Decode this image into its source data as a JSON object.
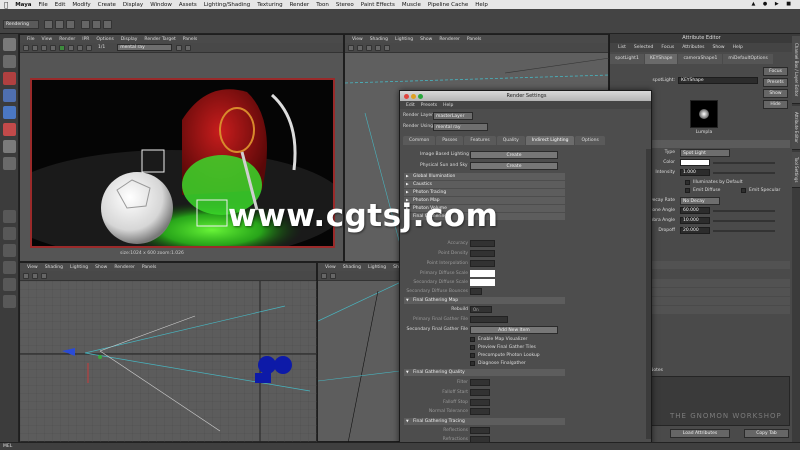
{
  "menubar": {
    "app": "Maya",
    "items": [
      "File",
      "Edit",
      "Modify",
      "Create",
      "Display",
      "Window",
      "Assets",
      "Lighting/Shading",
      "Texturing",
      "Render",
      "Toon",
      "Stereo",
      "Paint Effects",
      "Muscle",
      "Pipeline Cache",
      "Help"
    ]
  },
  "statusline": {
    "mode": "Rendering"
  },
  "render_view": {
    "menu": [
      "File",
      "View",
      "Render",
      "IPR",
      "Options",
      "Display",
      "Render Target",
      "Panels"
    ],
    "frame_label": "1/1",
    "camera_dropdown": "mental ray",
    "caption": "size:1024 x 600  zoom:1.026"
  },
  "persp_top": {
    "menu": [
      "View",
      "Shading",
      "Lighting",
      "Show",
      "Renderer",
      "Panels"
    ]
  },
  "vp_top": {
    "menu": [
      "View",
      "Shading",
      "Lighting",
      "Show",
      "Renderer",
      "Panels"
    ]
  },
  "vp_persp": {
    "menu": [
      "View",
      "Shading",
      "Lighting",
      "Show",
      "Renderer",
      "Panels"
    ]
  },
  "attribute_editor": {
    "title": "Attribute Editor",
    "menu": [
      "List",
      "Selected",
      "Focus",
      "Attributes",
      "Show",
      "Help"
    ],
    "tabs": [
      "spotLight1",
      "KEYShape",
      "cameraShape1",
      "miDefaultOptions"
    ],
    "node_label": "spotLight:",
    "node_value": "KEYShape",
    "focus_button": "Focus",
    "presets_button": "Presets",
    "show_button": "Show",
    "hide_button": "Hide",
    "swatch_label": "Lumpla",
    "section_title": "Light Attributes",
    "type_label": "Type",
    "type_value": "Spot Light",
    "color_label": "Color",
    "intensity_label": "Intensity",
    "intensity_value": "1.000",
    "illum_default": "Illuminates by Default",
    "emit_diffuse": "Emit Diffuse",
    "emit_specular": "Emit Specular",
    "decay_label": "Decay Rate",
    "decay_value": "No Decay",
    "cone_label": "Cone Angle",
    "cone_value": "60.000",
    "penumbra_label": "Penumbra Angle",
    "penumbra_value": "10.000",
    "dropoff_label": "Dropoff",
    "dropoff_value": "20.000",
    "sub_sections": [
      "Fects",
      "Shadows",
      "Fog",
      "Displace",
      "Attributes"
    ],
    "notes_label": "Notes",
    "load_button": "Load Attributes",
    "copy_button": "Copy Tab",
    "colors": {
      "light_color": "#ffffff",
      "swatch_bg": "#000000"
    }
  },
  "side_tabs": [
    "Channel Box / Layer Editor",
    "Attribute Editor",
    "Tool Settings"
  ],
  "render_settings": {
    "title": "Render Settings",
    "menu": [
      "Edit",
      "Presets",
      "Help"
    ],
    "render_layer_label": "Render Layer",
    "render_layer_value": "masterLayer",
    "render_using_label": "Render Using",
    "render_using_value": "mental ray",
    "tabs": [
      "Common",
      "Passes",
      "Features",
      "Quality",
      "Indirect Lighting",
      "Options"
    ],
    "active_tab": "Indirect Lighting",
    "ibl_label": "Image Based Lighting",
    "ibl_button": "Create",
    "physical_sun_label": "Physical Sun and Sky",
    "physical_sun_button": "Create",
    "sections": [
      "Global Illumination",
      "Caustics",
      "Photon Tracing",
      "Photon Map",
      "Photon Volume"
    ],
    "fg_section": "Final Gathering",
    "fg_fields": [
      "Accuracy",
      "Point Density",
      "Point Interpolation",
      "Primary Diffuse Scale",
      "Secondary Diffuse Scale",
      "Secondary Diffuse Bounces"
    ],
    "fg_map_section": "Final Gathering Map",
    "rebuild_label": "Rebuild",
    "rebuild_value": "On",
    "primary_file_label": "Primary Final Gather File",
    "secondary_file_label": "Secondary Final Gather File",
    "add_item_button": "Add New Item",
    "options": [
      "Enable Map Visualizer",
      "Preview Final Gather Tiles",
      "Precompute Photon Lookup",
      "Diagnose Finalgather"
    ],
    "fg_quality_section": "Final Gathering Quality",
    "quality_fields": [
      "Filter",
      "Falloff Start",
      "Falloff Stop",
      "Normal Tolerance"
    ],
    "fg_tracing_section": "Final Gathering Tracing",
    "tracing_fields": [
      "Reflections",
      "Refractions",
      "Max Trace Depth"
    ]
  },
  "watermark": {
    "text": "www.cgtsj.com"
  },
  "logo": {
    "text": "THE GNOMON WORKSHOP"
  },
  "helpline": {
    "text": "MEL"
  }
}
